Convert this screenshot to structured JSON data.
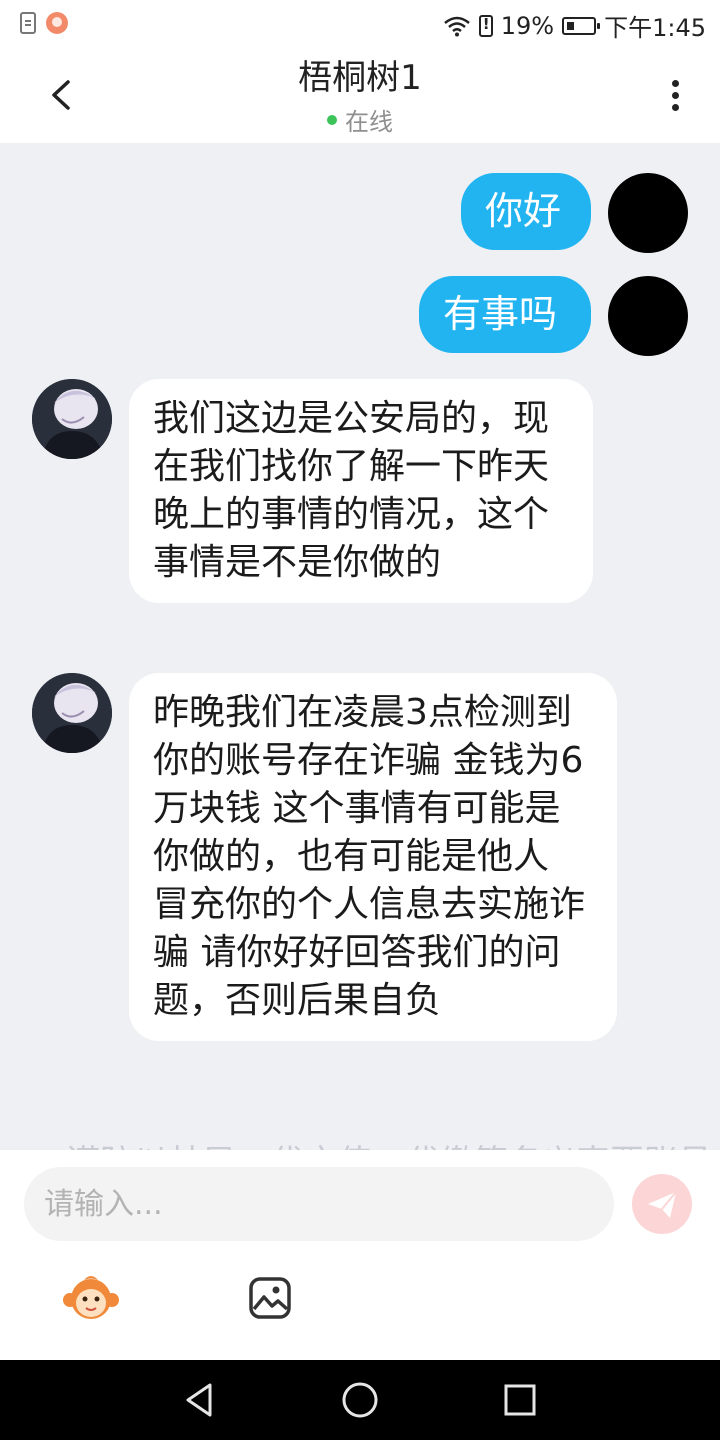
{
  "status_bar": {
    "battery_percent": "19%",
    "time": "下午1:45",
    "icons": [
      "doc-icon",
      "app-icon",
      "wifi-icon",
      "alert-icon",
      "battery-icon"
    ]
  },
  "header": {
    "title": "梧桐树1",
    "status": "在线",
    "status_color": "#3cc458"
  },
  "messages": [
    {
      "side": "sent",
      "text": "你好"
    },
    {
      "side": "sent",
      "text": "有事吗"
    },
    {
      "side": "received",
      "text": "我们这边是公安局的，现在我们找你了解一下昨天晚上的事情的情况，这个事情是不是你做的"
    },
    {
      "side": "received",
      "text": "昨晚我们在凌晨3点检测到你的账号存在诈骗 金钱为6万块钱 这个事情有可能是你做的，也有可能是他人 冒充你的个人信息去实施诈骗   请你好好回答我们的问题，否则后果自负"
    }
  ],
  "faded_notice": "谨防以林局、代充值、代缴等名义索要账号",
  "input": {
    "placeholder": "请输入..."
  },
  "colors": {
    "sent_bubble": "#22b4f0",
    "chat_background": "#eef0f4",
    "send_button": "#fcd6d6"
  }
}
